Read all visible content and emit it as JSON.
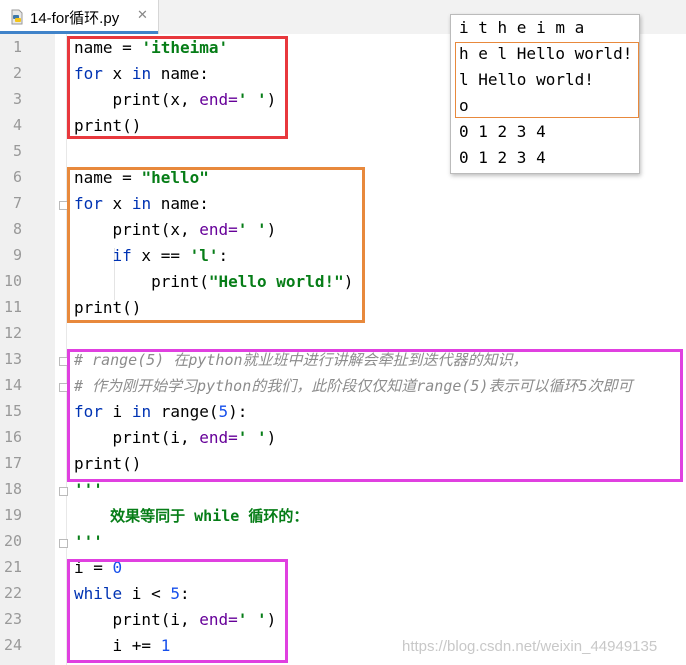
{
  "tab": {
    "title": "14-for循环.py",
    "close": "✕",
    "icon": "python-file-icon"
  },
  "lines": [
    {
      "n": "1"
    },
    {
      "n": "2"
    },
    {
      "n": "3"
    },
    {
      "n": "4"
    },
    {
      "n": "5"
    },
    {
      "n": "6"
    },
    {
      "n": "7"
    },
    {
      "n": "8"
    },
    {
      "n": "9"
    },
    {
      "n": "10"
    },
    {
      "n": "11"
    },
    {
      "n": "12"
    },
    {
      "n": "13"
    },
    {
      "n": "14"
    },
    {
      "n": "15"
    },
    {
      "n": "16"
    },
    {
      "n": "17"
    },
    {
      "n": "18"
    },
    {
      "n": "19"
    },
    {
      "n": "20"
    },
    {
      "n": "21"
    },
    {
      "n": "22"
    },
    {
      "n": "23"
    },
    {
      "n": "24"
    }
  ],
  "code": {
    "l1": {
      "a": "name = ",
      "b": "'itheima'"
    },
    "l2": {
      "a": "for",
      "b": " x ",
      "c": "in",
      "d": " name:"
    },
    "l3": {
      "a": "    print(x, ",
      "b": "end=",
      "c": "' '",
      ".d": ")"
    },
    "l4": {
      "a": "print()"
    },
    "l6": {
      "a": "name = ",
      "b": "\"hello\""
    },
    "l7": {
      "a": "for",
      "b": " x ",
      "c": "in",
      "d": " name:"
    },
    "l8": {
      "a": "    print(x, ",
      "b": "end=",
      "c": "' '",
      "d": ")"
    },
    "l9": {
      "a": "    ",
      "b": "if",
      "c": " x == ",
      "d": "'l'",
      "e": ":"
    },
    "l10": {
      "a": "        print(",
      "b": "\"Hello world!\"",
      "c": ")"
    },
    "l11": {
      "a": "print()"
    },
    "l13": {
      "a": "# range(5) 在python就业班中进行讲解会牵扯到迭代器的知识，"
    },
    "l14": {
      "a": "# 作为刚开始学习python的我们，此阶段仅仅知道range(5)表示可以循环5次即可"
    },
    "l15": {
      "a": "for",
      "b": " i ",
      "c": "in",
      "d": " range(",
      "e": "5",
      "f": "):"
    },
    "l16": {
      "a": "    print(i, ",
      "b": "end=",
      "c": "' '",
      "d": ")"
    },
    "l17": {
      "a": "print()"
    },
    "l18": {
      "a": "'''"
    },
    "l19": {
      "a": "    效果等同于 while 循环的："
    },
    "l20": {
      "a": "'''"
    },
    "l21": {
      "a": "i = ",
      "b": "0"
    },
    "l22": {
      "a": "while",
      "b": " i < ",
      "c": "5",
      "d": ":"
    },
    "l23": {
      "a": "    print(i, ",
      "b": "end=",
      "c": "' '",
      "d": ")"
    },
    "l24": {
      "a": "    i += ",
      "b": "1"
    }
  },
  "output": {
    "lines": [
      "i t h e i m a",
      "h e l Hello world!",
      "l Hello world!",
      "o",
      "0 1 2 3 4",
      "0 1 2 3 4"
    ]
  },
  "watermark": "https://blog.csdn.net/weixin_44949135",
  "colors": {
    "box_red": "#e8383d",
    "box_orange": "#e8893c",
    "box_magenta": "#e040e0",
    "keyword": "#0033b3",
    "string": "#067d17",
    "number": "#1750eb"
  }
}
